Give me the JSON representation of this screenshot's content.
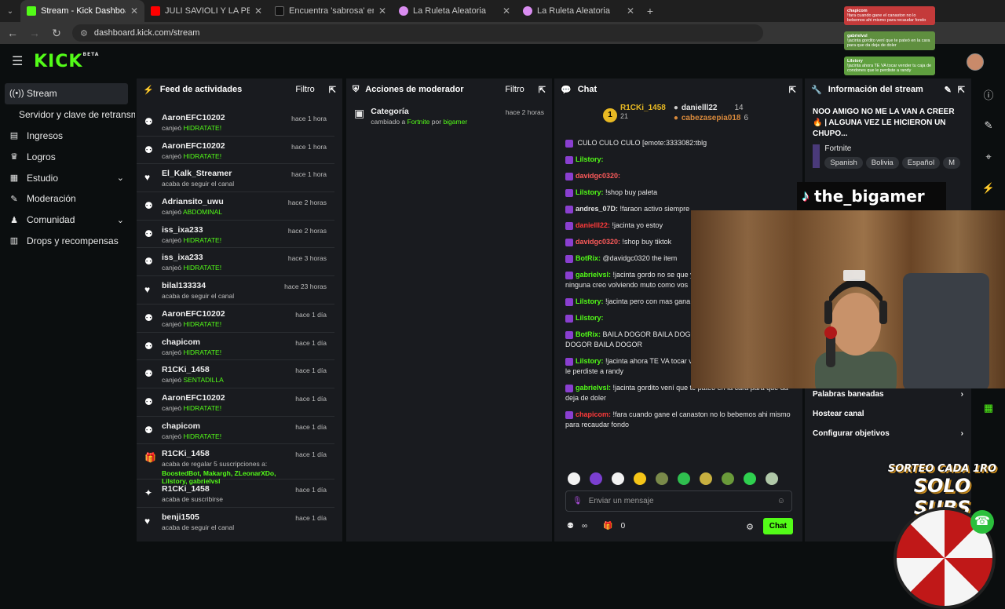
{
  "browser": {
    "tabs": [
      {
        "label": "Stream - Kick Dashboard",
        "color": "#53fc18"
      },
      {
        "label": "JULI SAVIOLI Y LA PEOR ENTREV",
        "color": "#ff0000"
      },
      {
        "label": "Encuentra 'sabrosa' en TikTok |",
        "color": "#111111"
      },
      {
        "label": "La Ruleta Aleatoria",
        "color": "#d98cf0"
      },
      {
        "label": "La Ruleta Aleatoria",
        "color": "#d98cf0"
      }
    ],
    "url": "dashboard.kick.com/stream"
  },
  "header": {
    "logo": "KICK",
    "beta": "BETA"
  },
  "leftnav": {
    "items": [
      {
        "label": "Stream",
        "icon": "(•)"
      },
      {
        "label": "Servidor y clave de retransmi",
        "icon": ""
      },
      {
        "label": "Ingresos",
        "icon": "▤"
      },
      {
        "label": "Logros",
        "icon": "🏆"
      },
      {
        "label": "Estudio",
        "icon": "▦"
      },
      {
        "label": "Moderación",
        "icon": "🔧"
      },
      {
        "label": "Comunidad",
        "icon": "👥"
      },
      {
        "label": "Drops y recompensas",
        "icon": "▥"
      }
    ]
  },
  "feed": {
    "title": "Feed de actividades",
    "filter": "Filtro",
    "rows": [
      {
        "user": "AaronEFC10202",
        "action": "canjeó",
        "highlight": "HIDRATATE!",
        "time": "hace 1 hora"
      },
      {
        "user": "AaronEFC10202",
        "action": "canjeó",
        "highlight": "HIDRATATE!",
        "time": "hace 1 hora"
      },
      {
        "user": "El_Kalk_Streamer",
        "action": "acaba de seguir el canal",
        "highlight": "",
        "time": "hace 1 hora"
      },
      {
        "user": "Adriansito_uwu",
        "action": "canjeó",
        "highlight": "ABDOMINAL",
        "time": "hace 2 horas"
      },
      {
        "user": "iss_ixa233",
        "action": "canjeó",
        "highlight": "HIDRATATE!",
        "time": "hace 2 horas"
      },
      {
        "user": "iss_ixa233",
        "action": "canjeó",
        "highlight": "HIDRATATE!",
        "time": "hace 3 horas"
      },
      {
        "user": "bilal133334",
        "action": "acaba de seguir el canal",
        "highlight": "",
        "time": "hace 23 horas"
      },
      {
        "user": "AaronEFC10202",
        "action": "canjeó",
        "highlight": "HIDRATATE!",
        "time": "hace 1 día"
      },
      {
        "user": "chapicom",
        "action": "canjeó",
        "highlight": "HIDRATATE!",
        "time": "hace 1 día"
      },
      {
        "user": "R1CKi_1458",
        "action": "canjeó",
        "highlight": "SENTADILLA",
        "time": "hace 1 día"
      },
      {
        "user": "AaronEFC10202",
        "action": "canjeó",
        "highlight": "HIDRATATE!",
        "time": "hace 1 día"
      },
      {
        "user": "chapicom",
        "action": "canjeó",
        "highlight": "HIDRATATE!",
        "time": "hace 1 día"
      }
    ],
    "gift_row": {
      "user": "R1CKi_1458",
      "line1": "acaba de regalar 5 suscripciones a:",
      "line2": "BoostedBot, Makargh, ZLeonarXDo, Lilstory, gabrielvsl",
      "time": "hace 1 día"
    },
    "sub_row": {
      "user": "R1CKi_1458",
      "action": "acaba de suscribirse",
      "time": "hace 1 día"
    },
    "last_row": {
      "user": "benji1505",
      "action": "acaba de seguir el canal",
      "time": "hace 1 día"
    }
  },
  "mod": {
    "title": "Acciones de moderador",
    "filter": "Filtro",
    "entry": {
      "label": "Categoría",
      "detail_prefix": "cambiado a",
      "game": "Fortnite",
      "by": "por",
      "user": "bigamer",
      "time": "hace 2 horas"
    }
  },
  "chat": {
    "title": "Chat",
    "leaders": [
      {
        "name": "R1CKi_1458",
        "count": "21"
      },
      {
        "name": "danielll22",
        "count": "14"
      },
      {
        "name": "cabezasepia018",
        "count": "6"
      }
    ],
    "messages": [
      {
        "user": "",
        "text": "CULO   CULO   CULO  [emote:3333082:tblg",
        "color": "#e6e6e6"
      },
      {
        "user": "Lilstory:",
        "text": "",
        "color": "#53fc18"
      },
      {
        "user": "davidgc0320:",
        "text": "",
        "color": "#ff5b5b"
      },
      {
        "user": "Lilstory:",
        "text": "!shop buy paleta",
        "color": "#53fc18"
      },
      {
        "user": "andres_07D:",
        "text": "!faraon activo siempre",
        "color": "#e6e6e6"
      },
      {
        "user": "danielll22:",
        "text": "!jacinta yo estoy",
        "color": "#ff3a3a"
      },
      {
        "user": "davidgc0320:",
        "text": "!shop buy tiktok",
        "color": "#ff5b5b"
      },
      {
        "user": "BotRix:",
        "text": "@davidgc0320 the item",
        "color": "#53fc18"
      },
      {
        "user": "gabrielvsl:",
        "text": "!jacinta gordo no se que y ahora ni me hablo con ninguna creo volviendo muto como vos",
        "color": "#53fc18"
      },
      {
        "user": "Lilstory:",
        "text": "!jacinta pero con mas gana diente que te duele",
        "color": "#53fc18"
      },
      {
        "user": "Lilstory:",
        "text": "",
        "color": "#53fc18"
      },
      {
        "user": "BotRix:",
        "text": "BAILA DOGOR   BAILA DOGOR   BAILA DOGOR   BAILA DOGOR   BAILA DOGOR",
        "color": "#53fc18"
      },
      {
        "user": "Lilstory:",
        "text": "!jacinta ahora TE VA tocar vender tu caja de condones que le perdiste a randy",
        "color": "#53fc18"
      },
      {
        "user": "gabrielvsl:",
        "text": "!jacinta gordito vení que te pateó en la cara para que da deja de doler",
        "color": "#53fc18"
      },
      {
        "user": "chapicom:",
        "text": "!fara cuando gane el canaston no lo bebemos ahi mismo para recaudar fondo",
        "color": "#ff3a3a"
      }
    ],
    "input_placeholder": "Enviar un mensaje",
    "infinity": "∞",
    "gift_count": "0",
    "send_label": "Chat"
  },
  "info": {
    "title": "Información del stream",
    "stream_title": "NOO AMIGO NO ME LA VAN A CREER🔥 | ALGUNA VEZ LE HICIERON UN CHUPO...",
    "category": "Fortnite",
    "tags": [
      "Spanish",
      "Bolivia",
      "Español",
      "M"
    ],
    "links": [
      "Palabras baneadas",
      "Hostear canal",
      "Configurar objetivos"
    ]
  },
  "overlays": {
    "tiktok_name": "the_bigamer",
    "sorteo_line1": "SORTEO CADA 1RO",
    "sorteo_line2": "SOLO SUBS",
    "notifications": [
      {
        "user": "chapicom",
        "text": "!fara cuando gane el canaston no lo bebemos ahi mismo para recaudar fondo",
        "bg": "#c43a3a"
      },
      {
        "user": "gabrielvsl",
        "text": "!jacinta gordito vení que te pateó en la cara para que da deja de doler",
        "bg": "#5f8f3f"
      },
      {
        "user": "Lilstory",
        "text": "!jacinta ahora TE VA tocar vender tu caja de condones que le perdiste a randy",
        "bg": "#5f9f3f"
      }
    ]
  }
}
